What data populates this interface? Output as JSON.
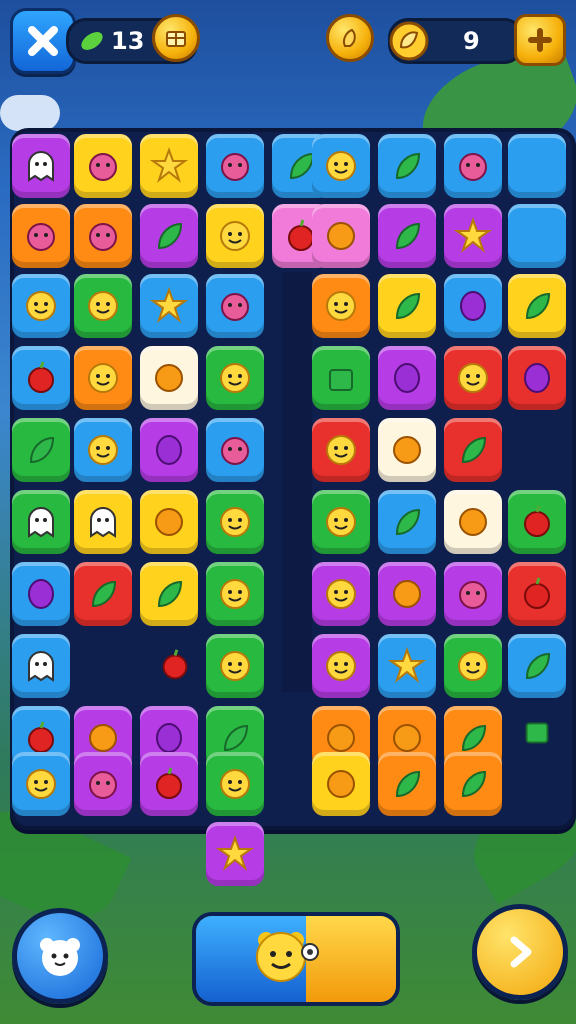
{
  "hud": {
    "left_counter": {
      "icon": "leaf-icon",
      "value": "13"
    },
    "right_counter": {
      "icon": "seed-icon",
      "value": "9"
    }
  },
  "buttons": {
    "close_icon": "close-icon",
    "add_icon": "plus-icon",
    "shop_icon": "treasure-icon",
    "hint_icon": "fruit-icon",
    "next_icon": "arrow-right-icon",
    "mascot_icon": "bear-face-icon"
  },
  "board": {
    "columns": 8,
    "rows": 10
  }
}
